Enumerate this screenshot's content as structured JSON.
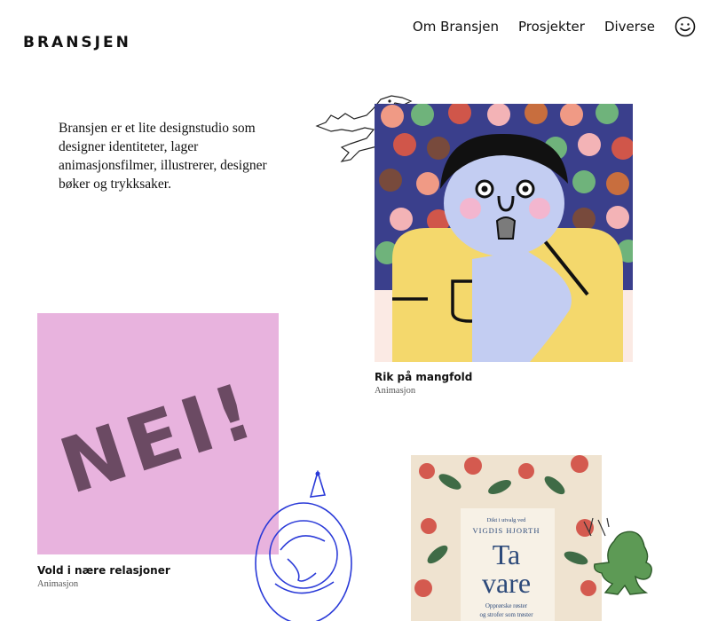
{
  "brand": {
    "logo_text": "BRANSJEN"
  },
  "nav": {
    "items": [
      {
        "label": "Om Bransjen"
      },
      {
        "label": "Prosjekter"
      },
      {
        "label": "Diverse"
      }
    ],
    "smile_icon": "smiley-face-icon"
  },
  "intro": {
    "text": "Bransjen er et lite designstudio som designer identiteter, lager animasjonsfilmer, illustrerer, designer bøker og trykksaker."
  },
  "projects": [
    {
      "title": "Rik på mangfold",
      "category": "Animasjon",
      "image_icon": "diverse-face-illustration"
    },
    {
      "title": "Vold i nære relasjoner",
      "category": "Animasjon",
      "image_text": "NEI!"
    },
    {
      "book_small": "Dikt i utvalg ved",
      "book_author": "VIGDIS HJORTH",
      "book_title_line1": "Ta",
      "book_title_line2": "vare",
      "book_sub_line1": "Opprørske røster",
      "book_sub_line2": "og strofer som trøster"
    }
  ],
  "colors": {
    "pink": "#e8b3de",
    "nei_text": "#6b4a63",
    "face_blue": "#c3cdf2",
    "shirt_yellow": "#f4d86c",
    "sketch_blue": "#2a3ad8",
    "green_creature": "#5d9a55"
  }
}
